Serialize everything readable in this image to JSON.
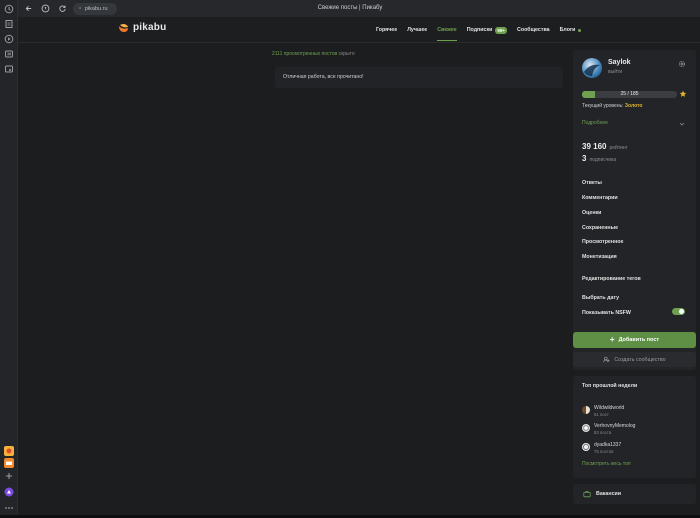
{
  "browser": {
    "url": "pikabu.ru",
    "window_title": "Свежие посты | Пикабу"
  },
  "header": {
    "logo_text": "pikabu",
    "nav": [
      {
        "label": "Горячее",
        "active": false
      },
      {
        "label": "Лучшее",
        "active": false
      },
      {
        "label": "Свежее",
        "active": true
      },
      {
        "label": "Подписки",
        "active": false
      },
      {
        "label": "Сообщества",
        "active": false
      },
      {
        "label": "Блоги",
        "active": false
      }
    ],
    "subscriptions_badge": "99+"
  },
  "feed": {
    "hidden_count_text": "2111 просмотренных постов",
    "hidden_suffix": "скрыто",
    "post_text": "Отличная работа, все прочитано!"
  },
  "profile": {
    "username": "Saylok",
    "status": "выйти",
    "progress_label": "25 / 185",
    "progress_fraction": 0.135,
    "level_prefix": "Текущий уровень:",
    "level_value": "Золото",
    "details_label": "Подробнее",
    "rating_value": "39 160",
    "rating_label": "рейтинг",
    "subscribers_value": "3",
    "subscribers_label": "подписчика",
    "menu": [
      "Ответы",
      "Комментарии",
      "Оценки",
      "Сохраненные",
      "Просмотренное",
      "Монетизация"
    ],
    "edit_tags": "Редактирование тегов",
    "choose_date": "Выбрать дату",
    "nsfw_label": "Показывать NSFW",
    "nsfw_on": true
  },
  "actions": {
    "add_post": "Добавить пост",
    "create_community": "Создать сообщество"
  },
  "top_week": {
    "title": "Топ прошлой недели",
    "items": [
      {
        "name": "Wildwildworld",
        "posts": "61 пост"
      },
      {
        "name": "VerhovnyMemolog",
        "posts": "83 поста"
      },
      {
        "name": "dyadka1337",
        "posts": "75 постов"
      }
    ],
    "view_all": "Посмотреть весь топ"
  },
  "vacancies": "Вакансии",
  "colors": {
    "accent": "#6fa150",
    "gold": "#e2b32c",
    "background": "#1c1d1f",
    "panel": "#232427"
  }
}
